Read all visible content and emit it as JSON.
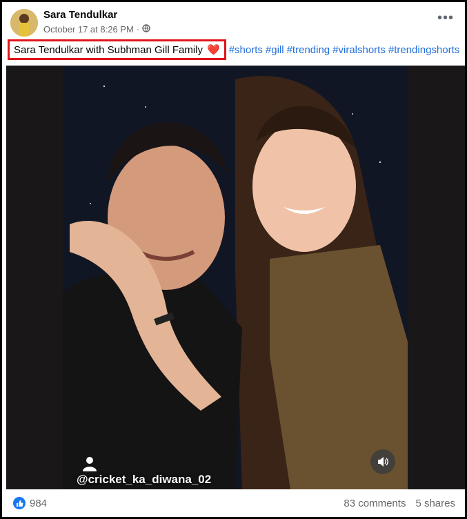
{
  "post": {
    "author": "Sara Tendulkar",
    "timestamp": "October 17 at 8:26 PM",
    "separator": "·",
    "privacy_icon": "globe-icon",
    "more_icon": "more-options-icon"
  },
  "caption": {
    "text": "Sara Tendulkar with Subhman Gill Family",
    "emoji": "❤️",
    "hashtags": [
      "#shorts",
      "#gill",
      "#trending",
      "#viralshorts",
      "#trendingshorts"
    ]
  },
  "media": {
    "watermark": "@cricket_ka_diwana_02",
    "sound_icon": "speaker-icon"
  },
  "stats": {
    "likes": "984",
    "comments": "83 comments",
    "shares": "5 shares"
  },
  "colors": {
    "link": "#216fdb",
    "highlight_border": "#e0141a",
    "like_blue": "#1877f2"
  }
}
